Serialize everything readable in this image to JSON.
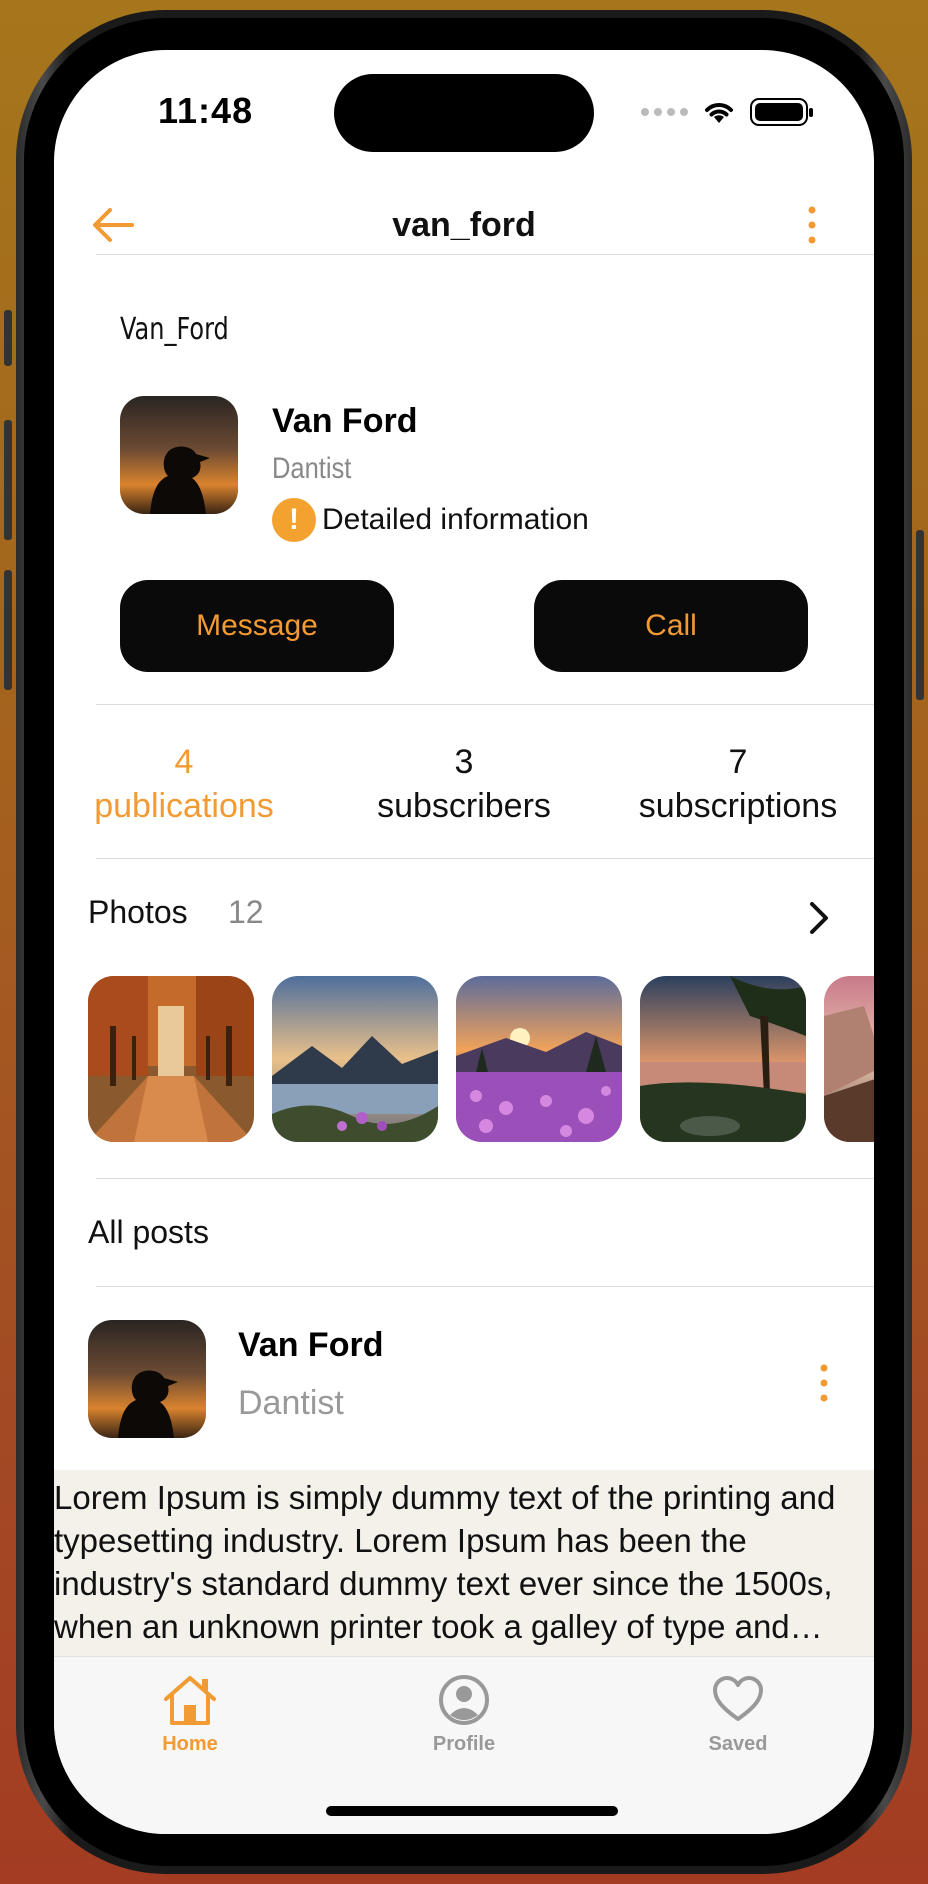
{
  "status_bar": {
    "time": "11:48"
  },
  "nav": {
    "title": "van_ford"
  },
  "profile": {
    "username": "Van_Ford",
    "name": "Van Ford",
    "role": "Dantist",
    "detail_label": "Detailed information",
    "message_label": "Message",
    "call_label": "Call"
  },
  "stats": [
    {
      "count": "4",
      "label": "publications",
      "active": true
    },
    {
      "count": "3",
      "label": "subscribers",
      "active": false
    },
    {
      "count": "7",
      "label": "subscriptions",
      "active": false
    }
  ],
  "photos": {
    "title": "Photos",
    "count": "12"
  },
  "posts": {
    "section_title": "All posts",
    "items": [
      {
        "name": "Van Ford",
        "role": "Dantist",
        "text": "Lorem Ipsum is simply dummy text of the printing and typesetting industry. Lorem Ipsum has been the industry's standard dummy text ever since the 1500s, when an unknown printer took a galley of type and scrambled it to make a type specimen book."
      }
    ]
  },
  "tabbar": {
    "items": [
      {
        "label": "Home",
        "icon": "home-icon",
        "active": true
      },
      {
        "label": "Profile",
        "icon": "person-circle-icon",
        "active": false
      },
      {
        "label": "Saved",
        "icon": "heart-icon",
        "active": false
      }
    ]
  },
  "colors": {
    "accent": "#f29a33",
    "button_bg": "#0a0a0a",
    "post_bg": "#f4f0ea"
  }
}
